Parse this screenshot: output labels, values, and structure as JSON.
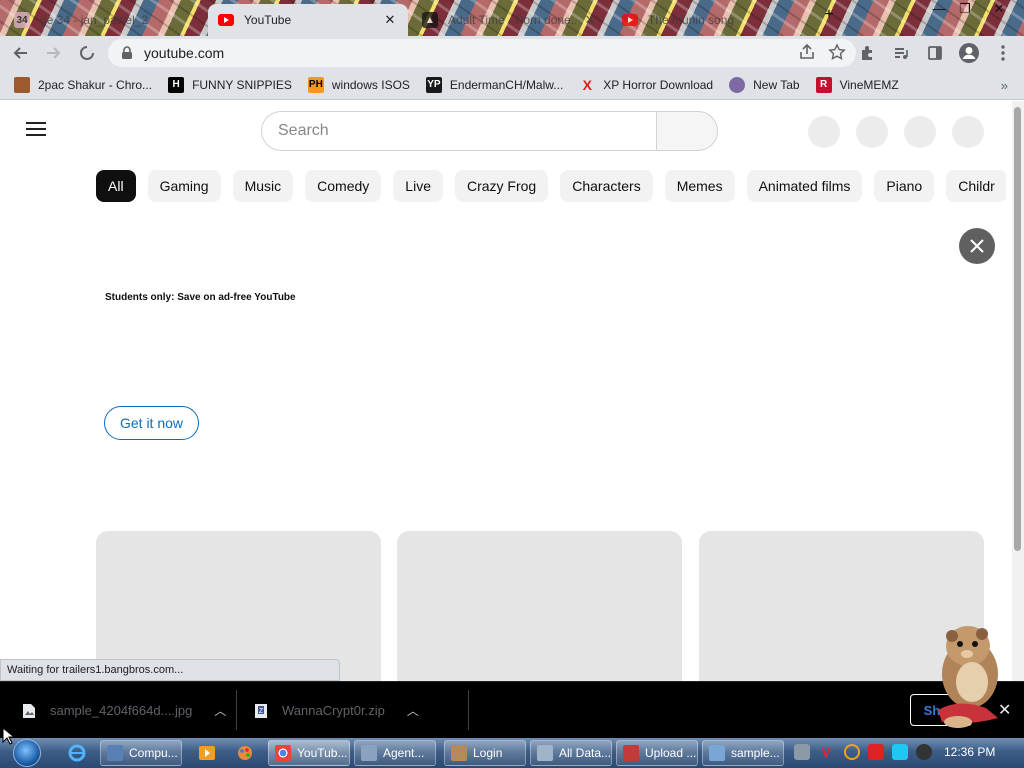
{
  "tabs": [
    {
      "title": "ge 34 - jan_pawel_2",
      "favicon_text": "34",
      "favicon_color": "#e9b2c9",
      "active": false
    },
    {
      "title": "YouTube",
      "favicon_color": "#ff0000",
      "active": true
    },
    {
      "title": "Adult Time - Porn done...",
      "favicon_text": "▲",
      "favicon_color": "#111111",
      "active": false
    },
    {
      "title": "The munin song",
      "favicon_color": "#ff0000",
      "active": false
    }
  ],
  "toolbar": {
    "url": "youtube.com",
    "back_icon": "arrow-left-icon",
    "forward_icon": "arrow-right-icon",
    "loading_icon": "spinner-icon"
  },
  "bookmarks": [
    {
      "label": "2pac Shakur - Chro...",
      "icon_text": "",
      "icon_color": "#9c5a2e"
    },
    {
      "label": "FUNNY SNIPPIES",
      "icon_text": "H",
      "icon_color": "#000000"
    },
    {
      "label": "windows ISOS",
      "icon_text": "PH",
      "icon_color": "#f7971d"
    },
    {
      "label": "EndermanCH/Malw...",
      "icon_text": "YP",
      "icon_color": "#1a1a1a"
    },
    {
      "label": "XP Horror Download",
      "icon_text": "X",
      "icon_color": "#e21b1b"
    },
    {
      "label": "New Tab",
      "icon_text": "",
      "icon_color": "#7d6aa5"
    },
    {
      "label": "VineMEMZ",
      "icon_text": "R",
      "icon_color": "#c4102c"
    }
  ],
  "youtube": {
    "search_placeholder": "Search",
    "chips": [
      "All",
      "Gaming",
      "Music",
      "Comedy",
      "Live",
      "Crazy Frog",
      "Characters",
      "Memes",
      "Animated films",
      "Piano",
      "Childr"
    ],
    "ad_text_prefix": "Students only:",
    "ad_text": "Save on ad-free YouTube",
    "ad_button": "Get it now"
  },
  "status": {
    "text": "Waiting for trailers1.bangbros.com..."
  },
  "downloads": [
    {
      "name": "sample_4204f664d....jpg"
    },
    {
      "name": "WannaCrypt0r.zip"
    }
  ],
  "shelf": {
    "show_all": "Show"
  },
  "taskbar": {
    "items": [
      {
        "label": "Compu...",
        "color": "#5a7fb5"
      },
      {
        "label": "YouTub...",
        "color": "#e8453c"
      },
      {
        "label": "Agent...",
        "color": "#8aa2bf"
      },
      {
        "label": "Login",
        "color": "#b58a5b"
      },
      {
        "label": "All Data...",
        "color": "#9fb3c9"
      },
      {
        "label": "Upload ...",
        "color": "#c23a3a"
      },
      {
        "label": "sample...",
        "color": "#7aa6d6"
      }
    ],
    "clock": "12:36 PM"
  }
}
